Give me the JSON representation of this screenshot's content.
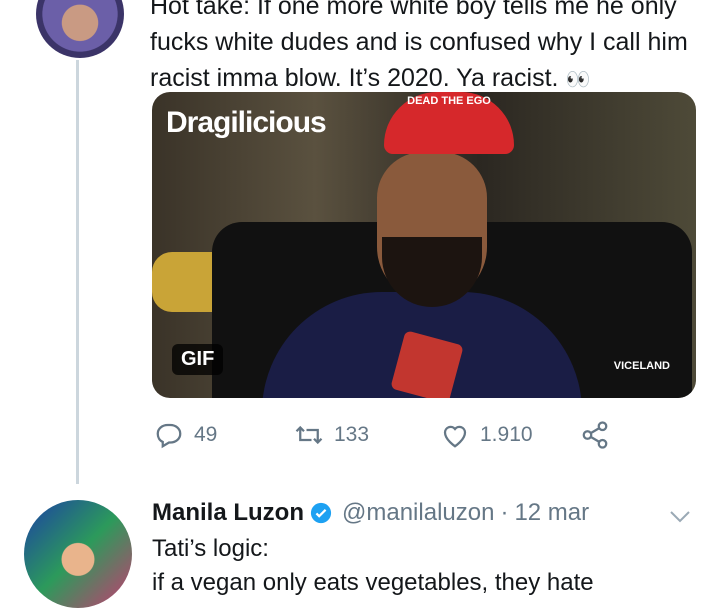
{
  "tweet": {
    "lines": [
      "Hot take: If one more white boy tells me he only",
      "fucks white dudes and is confused why I call him",
      "racist imma blow. It’s 2020. Ya racist."
    ],
    "emoji": "👀",
    "media": {
      "brand": "Dragilicious",
      "badge": "GIF",
      "watermark": "VICELAND",
      "cap_text": "DEAD THE EGO"
    },
    "actions": {
      "replies": "49",
      "retweets": "133",
      "likes": "1.910"
    },
    "icons": [
      "reply-icon",
      "retweet-icon",
      "like-icon",
      "share-icon"
    ]
  },
  "reply": {
    "name": "Manila Luzon",
    "handle": "@manilaluzon",
    "separator": "·",
    "date": "12 mar",
    "lines": [
      "Tati’s logic:",
      "if a vegan only eats vegetables, they hate"
    ]
  },
  "colors": {
    "text": "#14171a",
    "muted": "#657786",
    "verified": "#1da1f2",
    "thread_line": "#ccd6dd"
  }
}
